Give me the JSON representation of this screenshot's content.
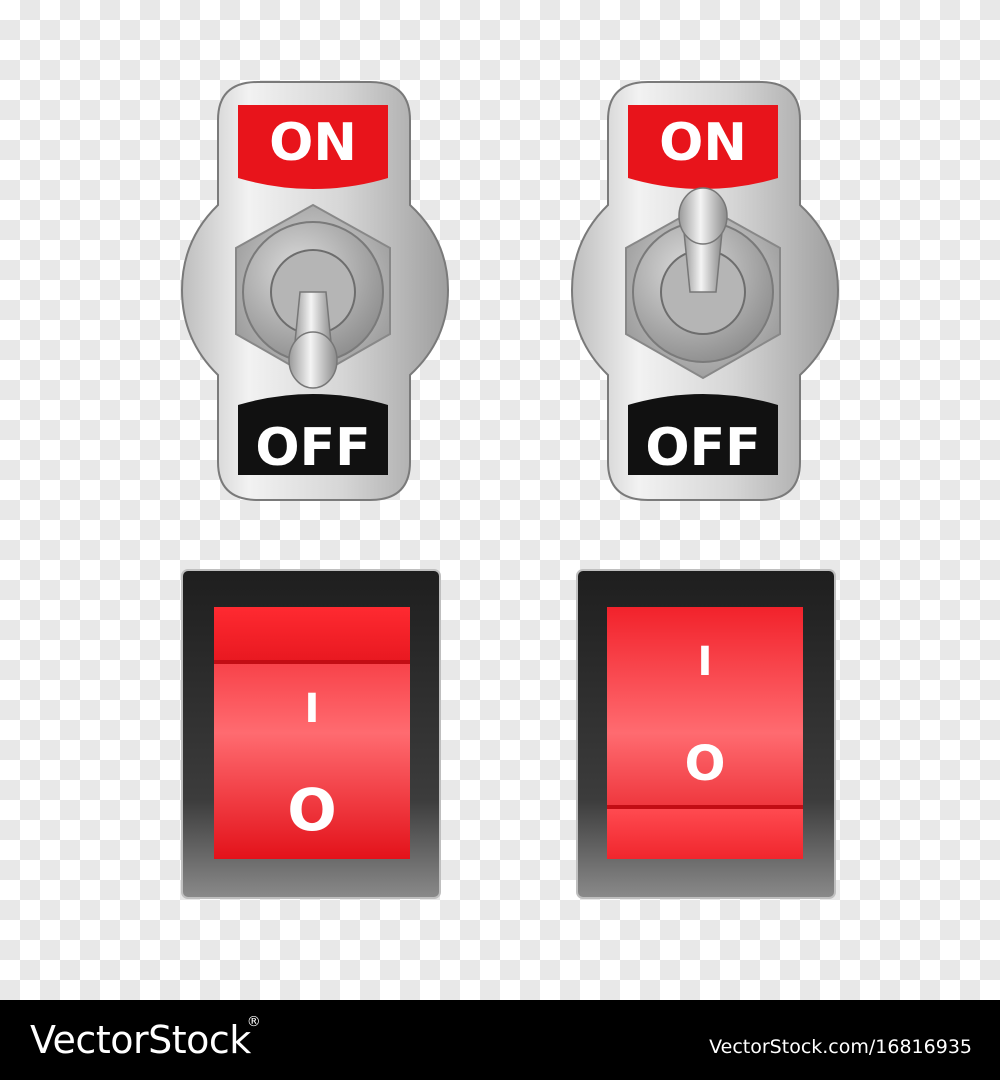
{
  "toggle_switches": [
    {
      "on_label": "ON",
      "off_label": "OFF",
      "position": "off"
    },
    {
      "on_label": "ON",
      "off_label": "OFF",
      "position": "on"
    }
  ],
  "rocker_switches": [
    {
      "on_symbol": "I",
      "off_symbol": "O",
      "position": "off"
    },
    {
      "on_symbol": "I",
      "off_symbol": "O",
      "position": "on"
    }
  ],
  "colors": {
    "label_red": "#e8141b",
    "label_black": "#111111",
    "rocker_red": "#ee1c25",
    "frame_dark": "#1a1a1a"
  },
  "watermark": {
    "logo_text": "VectorStock",
    "logo_mark": "®",
    "url": "VectorStock.com/16816935"
  }
}
